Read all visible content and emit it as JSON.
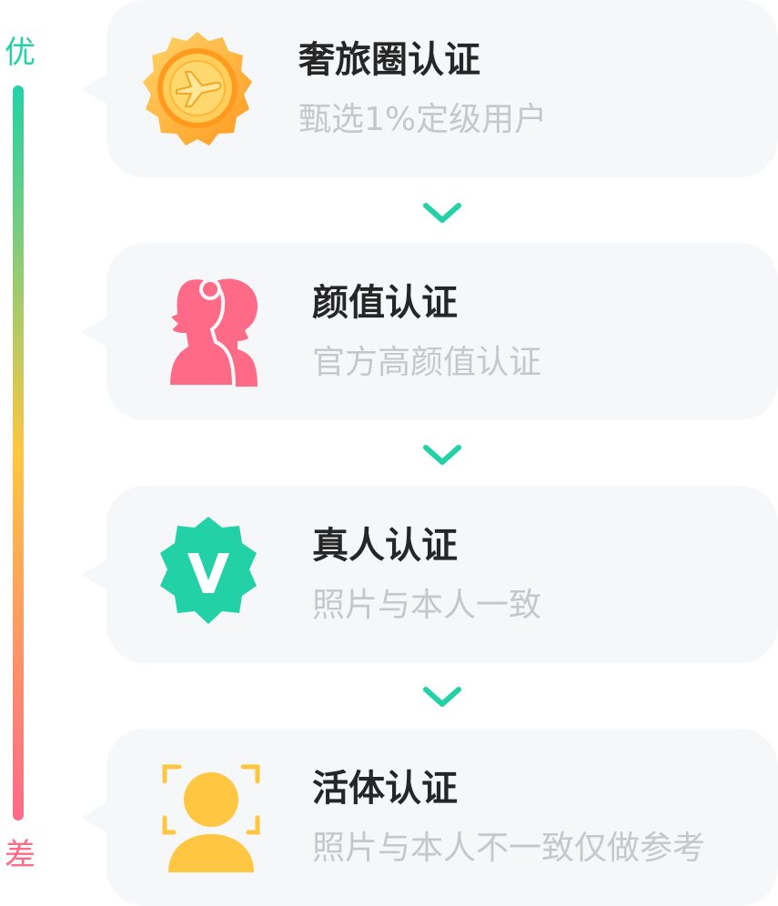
{
  "scale": {
    "top_label": "优",
    "bottom_label": "差",
    "colors": [
      "#22d1a5",
      "#ffc642",
      "#ff6a87"
    ]
  },
  "cards": [
    {
      "title": "奢旅圈认证",
      "subtitle": "甄选1%定级用户",
      "icon": "gold-plane-medal-icon"
    },
    {
      "title": "颜值认证",
      "subtitle": "官方高颜值认证",
      "icon": "couple-silhouette-icon"
    },
    {
      "title": "真人认证",
      "subtitle": "照片与本人一致",
      "icon": "verified-v-badge-icon"
    },
    {
      "title": "活体认证",
      "subtitle": "照片与本人不一致仅做参考",
      "icon": "face-scan-person-icon"
    }
  ],
  "connector_icon": "chevron-down-icon",
  "colors": {
    "card_bg": "#f6f7f9",
    "title": "#262626",
    "subtitle": "#c4c7cc",
    "accent_green": "#22d1a5",
    "pink": "#ff6a87",
    "gold": "#ffc642"
  }
}
